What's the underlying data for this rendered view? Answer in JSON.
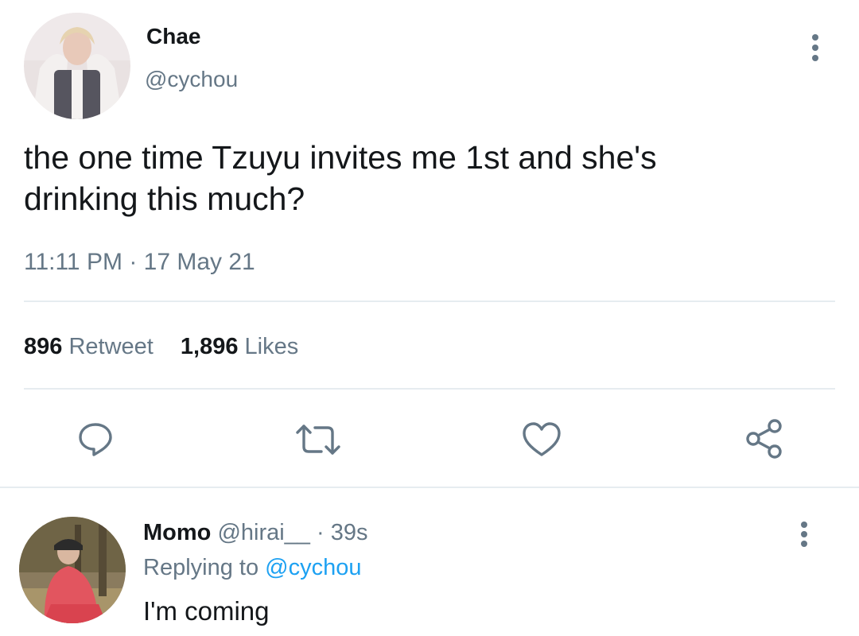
{
  "tweet": {
    "author_name": "Chae",
    "author_handle": "@cychou",
    "text_line1": "the one time Tzuyu invites me 1st and she's",
    "text_line2": "drinking this much?",
    "time": "11:11 PM",
    "separator": "·",
    "date": "17 May 21",
    "retweet_count": "896",
    "retweet_label": "Retweet",
    "like_count": "1,896",
    "like_label": "Likes"
  },
  "actions": [
    {
      "icon": "reply-icon"
    },
    {
      "icon": "retweet-icon"
    },
    {
      "icon": "heart-icon"
    },
    {
      "icon": "share-icon"
    }
  ],
  "reply": {
    "author_name": "Momo",
    "author_handle": "@hirai__",
    "separator": "·",
    "time_ago": "39s",
    "replying_prefix": "Replying to",
    "replying_handle": "@cychou",
    "text": "I'm coming"
  },
  "colors": {
    "text": "#14171a",
    "muted": "#657786",
    "link": "#1da1f2",
    "divider": "#e6ecf0"
  }
}
